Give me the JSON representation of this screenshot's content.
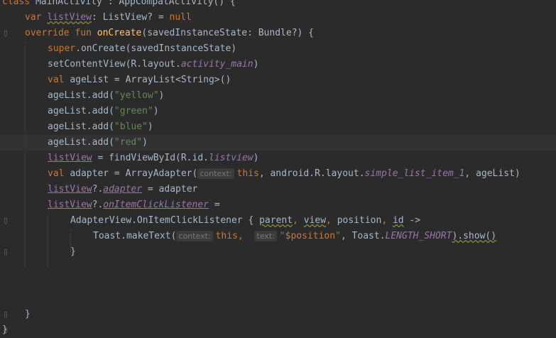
{
  "lines": [
    {
      "indent": 0,
      "tokens": [
        {
          "t": "class ",
          "c": "kw"
        },
        {
          "t": "MainActivity : AppCompatActivity() {"
        }
      ]
    },
    {
      "indent": 1,
      "tokens": [
        {
          "t": "var ",
          "c": "kw"
        },
        {
          "t": "listView",
          "c": "prop warn"
        },
        {
          "t": ": ListView? = "
        },
        {
          "t": "null",
          "c": "kw"
        }
      ]
    },
    {
      "indent": 1,
      "fold": true,
      "tokens": [
        {
          "t": "override fun ",
          "c": "kw"
        },
        {
          "t": "onCreate",
          "c": "fn"
        },
        {
          "t": "(savedInstanceState: Bundle?) {"
        }
      ]
    },
    {
      "indent": 2,
      "tokens": [
        {
          "t": "super",
          "c": "kw"
        },
        {
          "t": ".onCreate(savedInstanceState)"
        }
      ]
    },
    {
      "indent": 2,
      "tokens": [
        {
          "t": "setContentView(R.layout."
        },
        {
          "t": "activity_main",
          "c": "prop it"
        },
        {
          "t": ")"
        }
      ]
    },
    {
      "indent": 2,
      "tokens": [
        {
          "t": "val ",
          "c": "kw"
        },
        {
          "t": "ageList = ArrayList<String>()"
        }
      ]
    },
    {
      "indent": 2,
      "tokens": [
        {
          "t": "ageList.add("
        },
        {
          "t": "\"yellow\"",
          "c": "str"
        },
        {
          "t": ")"
        }
      ]
    },
    {
      "indent": 2,
      "tokens": [
        {
          "t": "ageList.add("
        },
        {
          "t": "\"green\"",
          "c": "str"
        },
        {
          "t": ")"
        }
      ]
    },
    {
      "indent": 2,
      "tokens": [
        {
          "t": "ageList.add("
        },
        {
          "t": "\"blue\"",
          "c": "str"
        },
        {
          "t": ")"
        }
      ]
    },
    {
      "indent": 2,
      "current": true,
      "tokens": [
        {
          "t": "ageList.add("
        },
        {
          "t": "\"red\"",
          "c": "str"
        },
        {
          "t": ")"
        }
      ]
    },
    {
      "indent": 2,
      "tokens": [
        {
          "t": "listView",
          "c": "prop ul"
        },
        {
          "t": " = findViewById(R.id."
        },
        {
          "t": "listview",
          "c": "prop it"
        },
        {
          "t": ")"
        }
      ]
    },
    {
      "indent": 2,
      "tokens": [
        {
          "t": "val ",
          "c": "kw"
        },
        {
          "t": "adapter = ArrayAdapter("
        },
        {
          "t": "context:",
          "c": "hint"
        },
        {
          "t": "this",
          "c": "kw"
        },
        {
          "t": ", "
        },
        {
          "t": "android.R.layout."
        },
        {
          "t": "simple_list_item_1",
          "c": "prop it"
        },
        {
          "t": ", ageList)"
        }
      ]
    },
    {
      "indent": 2,
      "tokens": [
        {
          "t": "listView",
          "c": "prop ul"
        },
        {
          "t": "?."
        },
        {
          "t": "adapter",
          "c": "prop it ul"
        },
        {
          "t": " = adapter"
        }
      ]
    },
    {
      "indent": 2,
      "tokens": [
        {
          "t": "listView",
          "c": "prop ul"
        },
        {
          "t": "?."
        },
        {
          "t": "onItemClickListener",
          "c": "prop it ul"
        },
        {
          "t": " ="
        }
      ]
    },
    {
      "indent": 3,
      "fold": true,
      "tokens": [
        {
          "t": "AdapterView.OnItemClickListener { "
        },
        {
          "t": "parent",
          "c": "warn"
        },
        {
          "t": ", ",
          "c": "kw"
        },
        {
          "t": "view",
          "c": "warn"
        },
        {
          "t": ", ",
          "c": "kw"
        },
        {
          "t": "position"
        },
        {
          "t": ", ",
          "c": "kw"
        },
        {
          "t": "id",
          "c": "warn"
        },
        {
          "t": " ->"
        }
      ]
    },
    {
      "indent": 4,
      "tokens": [
        {
          "t": "Toast.makeText("
        },
        {
          "t": "context:",
          "c": "hint"
        },
        {
          "t": "this",
          "c": "kw"
        },
        {
          "t": ",  ",
          "c": "kw"
        },
        {
          "t": "text:",
          "c": "hint"
        },
        {
          "t": "\"",
          "c": "str"
        },
        {
          "t": "$position",
          "c": "kw"
        },
        {
          "t": "\"",
          "c": "str"
        },
        {
          "t": ", Toast."
        },
        {
          "t": "LENGTH_SHORT",
          "c": "prop it"
        },
        {
          "t": ").show()",
          "c": "warn"
        }
      ]
    },
    {
      "indent": 3,
      "fold": true,
      "tokens": [
        {
          "t": "}"
        }
      ]
    },
    {
      "indent": 0,
      "tokens": []
    },
    {
      "indent": 0,
      "tokens": []
    },
    {
      "indent": 0,
      "tokens": []
    },
    {
      "indent": 1,
      "fold": true,
      "tokens": [
        {
          "t": "}"
        }
      ]
    },
    {
      "indent": 0,
      "fold": true,
      "tokens": [
        {
          "t": "}"
        }
      ]
    }
  ]
}
